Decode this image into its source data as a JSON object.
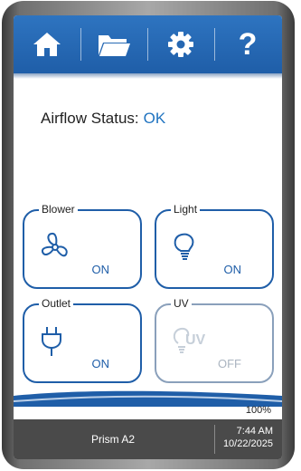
{
  "nav": {
    "home_icon": "home-icon",
    "folder_icon": "folder-icon",
    "settings_icon": "gear-icon",
    "help_label": "?"
  },
  "status": {
    "label": "Airflow Status:",
    "value": "OK"
  },
  "tiles": [
    {
      "label": "Blower",
      "state": "ON",
      "icon": "fan-icon"
    },
    {
      "label": "Light",
      "state": "ON",
      "icon": "lightbulb-icon"
    },
    {
      "label": "Outlet",
      "state": "ON",
      "icon": "plug-icon"
    },
    {
      "label": "UV",
      "state": "OFF",
      "icon": "uv-lamp-icon",
      "uv_text": "UV"
    }
  ],
  "footer": {
    "percent": "100%",
    "device_name": "Prism A2",
    "time": "7:44 AM",
    "date": "10/22/2025"
  },
  "colors": {
    "accent": "#1f5ea8",
    "status_ok": "#1f73c0",
    "footer_bg": "#4a4a4a"
  }
}
